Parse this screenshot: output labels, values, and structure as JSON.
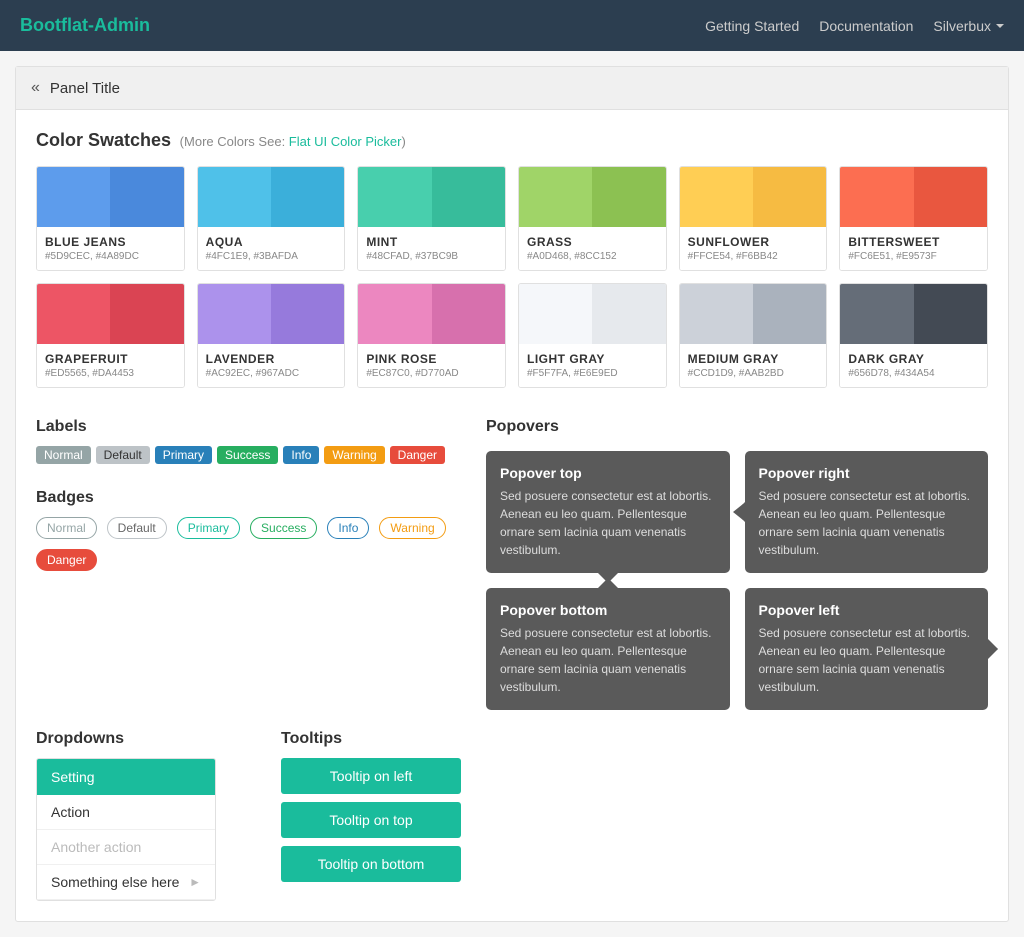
{
  "navbar": {
    "brand": "Bootflat-Admin",
    "nav_items": [
      {
        "label": "Getting Started",
        "href": "#"
      },
      {
        "label": "Documentation",
        "href": "#"
      },
      {
        "label": "Silverbux",
        "dropdown": true
      }
    ]
  },
  "panel": {
    "title": "Panel Title"
  },
  "color_swatches": {
    "title": "Color Swatches",
    "subtitle_prefix": "More Colors See",
    "subtitle_link": "Flat UI Color Picker",
    "colors": [
      {
        "name": "BLUE JEANS",
        "codes": "#5D9CEC, #4A89DC",
        "color1": "#5D9CEC",
        "color2": "#4A89DC"
      },
      {
        "name": "AQUA",
        "codes": "#4FC1E9, #3BAFDA",
        "color1": "#4FC1E9",
        "color2": "#3BAFDA"
      },
      {
        "name": "MINT",
        "codes": "#48CFAD, #37BC9B",
        "color1": "#48CFAD",
        "color2": "#37BC9B"
      },
      {
        "name": "GRASS",
        "codes": "#A0D468, #8CC152",
        "color1": "#A0D468",
        "color2": "#8CC152"
      },
      {
        "name": "SUNFLOWER",
        "codes": "#FFCE54, #F6BB42",
        "color1": "#FFCE54",
        "color2": "#F6BB42"
      },
      {
        "name": "BITTERSWEET",
        "codes": "#FC6E51, #E9573F",
        "color1": "#FC6E51",
        "color2": "#E9573F"
      },
      {
        "name": "GRAPEFRUIT",
        "codes": "#ED5565, #DA4453",
        "color1": "#ED5565",
        "color2": "#DA4453"
      },
      {
        "name": "LAVENDER",
        "codes": "#AC92EC, #967ADC",
        "color1": "#AC92EC",
        "color2": "#967ADC"
      },
      {
        "name": "PINK ROSE",
        "codes": "#EC87C0, #D770AD",
        "color1": "#EC87C0",
        "color2": "#D770AD"
      },
      {
        "name": "LIGHT GRAY",
        "codes": "#F5F7FA, #E6E9ED",
        "color1": "#F5F7FA",
        "color2": "#E6E9ED"
      },
      {
        "name": "MEDIUM GRAY",
        "codes": "#CCD1D9, #AAB2BD",
        "color1": "#CCD1D9",
        "color2": "#AAB2BD"
      },
      {
        "name": "DARK GRAY",
        "codes": "#656D78, #434A54",
        "color1": "#656D78",
        "color2": "#434A54"
      }
    ]
  },
  "labels": {
    "title": "Labels",
    "items": [
      {
        "text": "Normal",
        "style": "normal"
      },
      {
        "text": "Default",
        "style": "default"
      },
      {
        "text": "Primary",
        "style": "primary"
      },
      {
        "text": "Success",
        "style": "success"
      },
      {
        "text": "Info",
        "style": "info"
      },
      {
        "text": "Warning",
        "style": "warning"
      },
      {
        "text": "Danger",
        "style": "danger"
      }
    ]
  },
  "badges": {
    "title": "Badges",
    "items": [
      {
        "text": "Normal",
        "style": "normal"
      },
      {
        "text": "Default",
        "style": "default"
      },
      {
        "text": "Primary",
        "style": "primary"
      },
      {
        "text": "Success",
        "style": "success"
      },
      {
        "text": "Info",
        "style": "info"
      },
      {
        "text": "Warning",
        "style": "warning"
      },
      {
        "text": "Danger",
        "style": "danger"
      }
    ]
  },
  "dropdowns": {
    "title": "Dropdowns",
    "menu": {
      "header": "Setting",
      "items": [
        {
          "text": "Action",
          "muted": false
        },
        {
          "text": "Another action",
          "muted": true
        },
        {
          "text": "Something else here",
          "arrow": true
        }
      ]
    }
  },
  "tooltips": {
    "title": "Tooltips",
    "buttons": [
      {
        "label": "Tooltip on left"
      },
      {
        "label": "Tooltip on top"
      },
      {
        "label": "Tooltip on bottom"
      }
    ]
  },
  "popovers": {
    "title": "Popovers",
    "items": [
      {
        "position": "top",
        "title": "Popover top",
        "text": "Sed posuere consectetur est at lobortis. Aenean eu leo quam. Pellentesque ornare sem lacinia quam venenatis vestibulum."
      },
      {
        "position": "right",
        "title": "Popover right",
        "text": "Sed posuere consectetur est at lobortis. Aenean eu leo quam. Pellentesque ornare sem lacinia quam venenatis vestibulum."
      },
      {
        "position": "bottom",
        "title": "Popover bottom",
        "text": "Sed posuere consectetur est at lobortis. Aenean eu leo quam. Pellentesque ornare sem lacinia quam venenatis vestibulum."
      },
      {
        "position": "left",
        "title": "Popover left",
        "text": "Sed posuere consectetur est at lobortis. Aenean eu leo quam. Pellentesque ornare sem lacinia quam venenatis vestibulum."
      }
    ]
  }
}
